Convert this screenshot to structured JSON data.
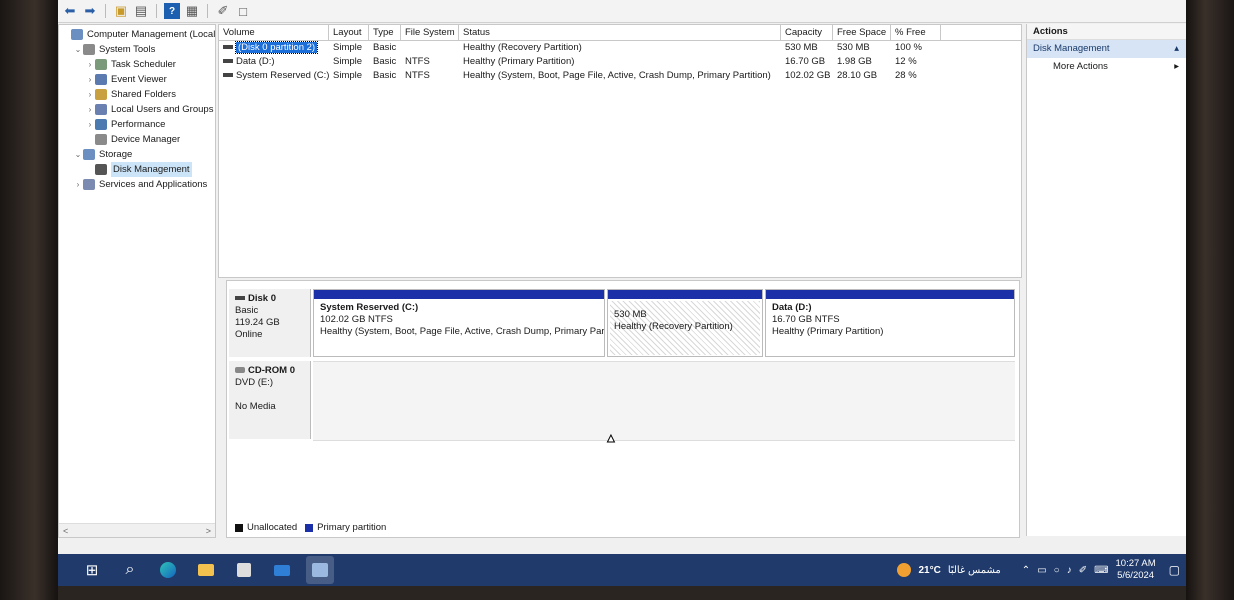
{
  "tree": {
    "items": [
      {
        "label": "Computer Management (Local",
        "icon": "computer-icon",
        "depth": 0,
        "arrow": ""
      },
      {
        "label": "System Tools",
        "icon": "tools-icon",
        "depth": 1,
        "arrow": "v"
      },
      {
        "label": "Task Scheduler",
        "icon": "clock-icon",
        "depth": 2,
        "arrow": ">"
      },
      {
        "label": "Event Viewer",
        "icon": "event-viewer-icon",
        "depth": 2,
        "arrow": ">"
      },
      {
        "label": "Shared Folders",
        "icon": "folder-icon",
        "depth": 2,
        "arrow": ">"
      },
      {
        "label": "Local Users and Groups",
        "icon": "users-icon",
        "depth": 2,
        "arrow": ">"
      },
      {
        "label": "Performance",
        "icon": "performance-icon",
        "depth": 2,
        "arrow": ">"
      },
      {
        "label": "Device Manager",
        "icon": "device-manager-icon",
        "depth": 2,
        "arrow": ""
      },
      {
        "label": "Storage",
        "icon": "storage-icon",
        "depth": 1,
        "arrow": "v"
      },
      {
        "label": "Disk Management",
        "icon": "disk-icon",
        "depth": 2,
        "arrow": "",
        "selected": true
      },
      {
        "label": "Services and Applications",
        "icon": "services-icon",
        "depth": 1,
        "arrow": ">"
      }
    ]
  },
  "list": {
    "headers": {
      "volume": "Volume",
      "layout": "Layout",
      "type": "Type",
      "fs": "File System",
      "status": "Status",
      "capacity": "Capacity",
      "free": "Free Space",
      "pct": "% Free"
    },
    "rows": [
      {
        "volume": "(Disk 0 partition 2)",
        "layout": "Simple",
        "type": "Basic",
        "fs": "",
        "status": "Healthy (Recovery Partition)",
        "capacity": "530 MB",
        "free": "530 MB",
        "pct": "100 %"
      },
      {
        "volume": "Data (D:)",
        "layout": "Simple",
        "type": "Basic",
        "fs": "NTFS",
        "status": "Healthy (Primary Partition)",
        "capacity": "16.70 GB",
        "free": "1.98 GB",
        "pct": "12 %"
      },
      {
        "volume": "System Reserved (C:)",
        "layout": "Simple",
        "type": "Basic",
        "fs": "NTFS",
        "status": "Healthy (System, Boot, Page File, Active, Crash Dump, Primary Partition)",
        "capacity": "102.02 GB",
        "free": "28.10 GB",
        "pct": "28 %"
      }
    ]
  },
  "disk0": {
    "name": "Disk 0",
    "kind": "Basic",
    "size": "119.24 GB",
    "state": "Online",
    "partitions": [
      {
        "title": "System Reserved  (C:)",
        "size": "102.02 GB NTFS",
        "status": "Healthy (System, Boot, Page File, Active, Crash Dump, Primary Par"
      },
      {
        "title": "",
        "size": "530 MB",
        "status": "Healthy (Recovery Partition)"
      },
      {
        "title": "Data  (D:)",
        "size": "16.70 GB NTFS",
        "status": "Healthy (Primary Partition)"
      }
    ]
  },
  "cdrom": {
    "name": "CD-ROM 0",
    "drive": "DVD (E:)",
    "media": "No Media"
  },
  "legend": {
    "unallocated": "Unallocated",
    "primary": "Primary partition"
  },
  "actions": {
    "header": "Actions",
    "section": "Disk Management",
    "more": "More Actions"
  },
  "tray": {
    "weather": "21°C",
    "weather_text": "مشمس غالبًا",
    "time": "10:27 AM",
    "date": "5/6/2024"
  },
  "colors": {
    "primary_partition": "#1a2fa8",
    "unallocated": "#111111",
    "taskbar": "#1f3a6b",
    "selection": "#1c6fd9"
  }
}
